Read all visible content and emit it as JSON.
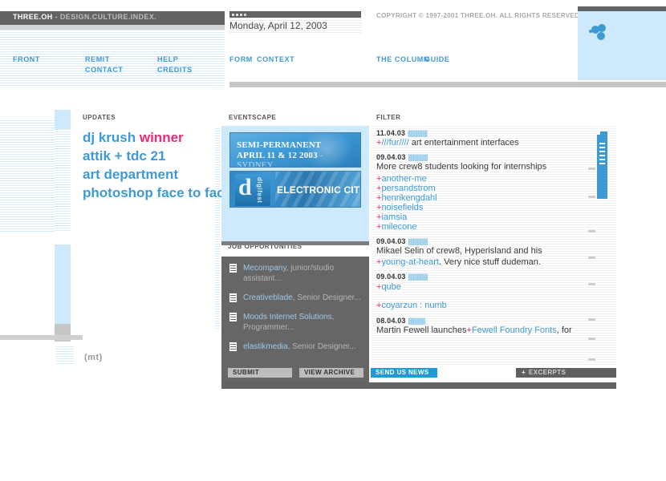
{
  "header": {
    "brand": "THREE.OH",
    "brand_tail": " - DESIGN.CULTURE.INDEX.",
    "date": "Monday, April 12, 2003",
    "copyright": "COPYRIGHT © 1997-2001 THREE.OH. ALL RIGHTS RESERVED.",
    "logo_icon": "three-circles-logo"
  },
  "nav": {
    "front": "FRONT",
    "remit": "REMIT",
    "contact": "CONTACT",
    "help": "HELP",
    "credits": "CREDITS",
    "form": "FORM",
    "context": "CONTEXT",
    "column": "THE COLUMN",
    "guide": "GUIDE"
  },
  "sections": {
    "updates": "UPDATES",
    "eventscape": "EVENTSCAPE",
    "jobs": "JOB OPPORTUNITIES",
    "filter": "FILTER"
  },
  "updates": {
    "items": [
      {
        "text": "dj krush ",
        "highlight": "winner"
      },
      {
        "text": "attik + tdc 21",
        "highlight": ""
      },
      {
        "text": "art department",
        "highlight": ""
      },
      {
        "text": "photoshop face to face",
        "highlight": ""
      }
    ]
  },
  "sponsor": {
    "mt_logo": "(mt)"
  },
  "eventscape": {
    "banners": [
      {
        "name": "semi-permanent",
        "line1": "SEMI-PERMANENT",
        "line2": "APRIL 11 & 12 2003",
        "line2_muted": " - SYDNEY"
      },
      {
        "name": "digifest-electronic-cities",
        "mark": "d",
        "vertical": "digifest",
        "title": "ELECTRONIC CITIES"
      }
    ]
  },
  "jobs": {
    "items": [
      {
        "company": "Mecompany",
        "role": ", junior/studio assistant..."
      },
      {
        "company": "Creativeblade",
        "role": ", Senior Designer..."
      },
      {
        "company": "Moods Internet Solutions",
        "role": ", Programmer..."
      },
      {
        "company": "elastikmedia",
        "role": ", Senior Designer..."
      }
    ],
    "submit_label": "SUBMIT",
    "archive_label": "VIEW ARCHIVE"
  },
  "filter": {
    "entries": [
      {
        "date": "11.04.03",
        "ticks": "||||||||||||||||",
        "plus": "+",
        "link": "///fur////",
        "rest": " art entertainment interfaces",
        "links": []
      },
      {
        "date": "09.04.03",
        "ticks": "||||||||||||||||",
        "plus": "",
        "link": "",
        "rest": "More crew8 students looking for internships",
        "links": [
          "another-me",
          "persandstrom",
          "henrikengdahl",
          "noisefields",
          "iamsia",
          "milecone"
        ]
      },
      {
        "date": "09.04.03",
        "ticks": "||||||||||||||||",
        "plus": "",
        "link": "",
        "rest": "Mikael Selin of crew8, Hyperisland and his",
        "rest2_plus": "+",
        "rest2_link": "young-at-heart",
        "rest2": ". Very nice stuff dudeman.",
        "links": []
      },
      {
        "date": "09.04.03",
        "ticks": "||||||||||||||||",
        "plus": "",
        "link": "",
        "rest": "",
        "links": [
          "qube",
          "",
          "coyarzun : numb"
        ]
      },
      {
        "date": "08.04.03",
        "ticks": "||||||||||||||",
        "plus": "",
        "link": "",
        "rest": "Martin Fewell launches",
        "rest2_plus": "+",
        "rest2_link": "Fewell Foundry Fonts",
        "rest2": ", for",
        "links": []
      }
    ],
    "send_label": "SEND US NEWS",
    "excerpts_label": "EXCERPTS",
    "excerpts_plus": "+",
    "scrollbar": "vertical-scrollbar"
  },
  "colors": {
    "accent_blue": "#3d9ad4",
    "accent_pink": "#ec2a74",
    "panel_blue": "#cde9fb",
    "dark_grey": "#636363",
    "jobs_grey": "#666666"
  }
}
